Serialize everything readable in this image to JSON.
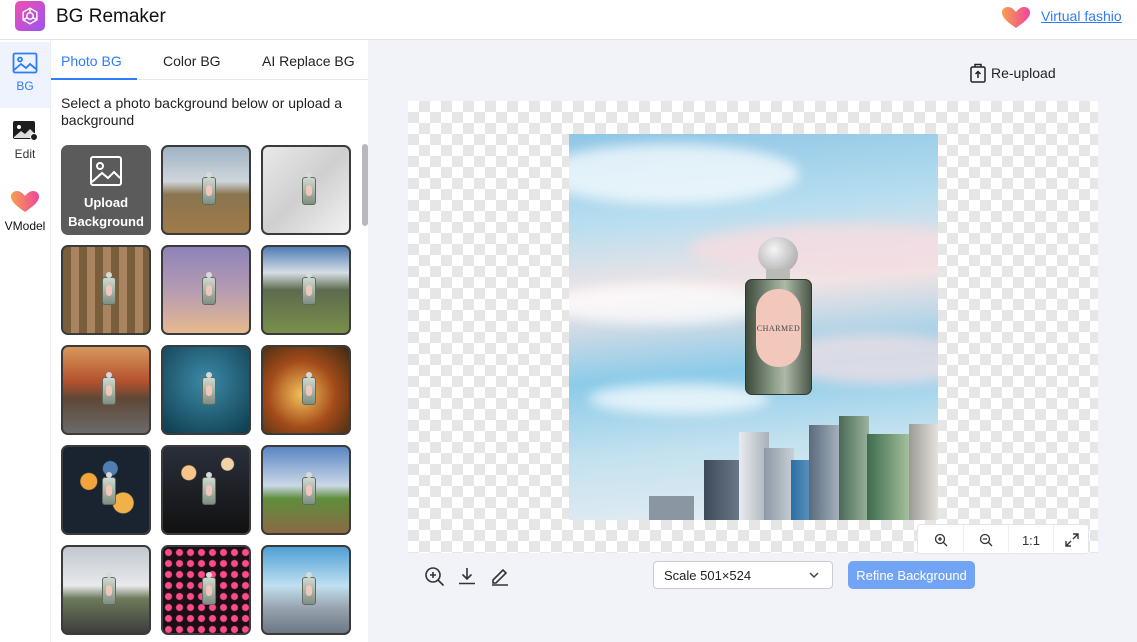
{
  "app": {
    "title": "BG Remaker",
    "logo_icon": "openai-knot-icon"
  },
  "header": {
    "virtual_fashion_link": "Virtual fashio",
    "heart_icon": "gradient-heart-icon"
  },
  "rail": {
    "items": [
      {
        "label": "BG",
        "icon": "image-icon",
        "active": true
      },
      {
        "label": "Edit",
        "icon": "edit-image-icon",
        "active": false
      },
      {
        "label": "VModel",
        "icon": "gradient-heart-icon",
        "active": false
      }
    ]
  },
  "panel": {
    "tabs": [
      {
        "label": "Photo BG",
        "active": true
      },
      {
        "label": "Color BG",
        "active": false
      },
      {
        "label": "AI Replace BG",
        "active": false
      }
    ],
    "instruction": "Select a photo background below or upload a background",
    "upload_label_line1": "Upload",
    "upload_label_line2": "Background",
    "backgrounds": [
      "desert-landscape",
      "marble-surface",
      "carved-stone-door",
      "purple-sunset-sky",
      "mountain-cabin-path",
      "red-rock-road",
      "teal-studio",
      "autumn-forest-sunset",
      "golden-bokeh",
      "city-night-bokeh",
      "country-road",
      "highway-clouds",
      "pink-light-tunnel",
      "city-skyline"
    ]
  },
  "canvas": {
    "reupload_label": "Re-upload",
    "product_label": "CHARMED",
    "zoom": {
      "one_to_one": "1:1"
    },
    "scale_label": "Scale 501×524",
    "refine_button": "Refine Background"
  },
  "colors": {
    "accent": "#2f7cf6",
    "refine_button": "#72a4f6"
  }
}
